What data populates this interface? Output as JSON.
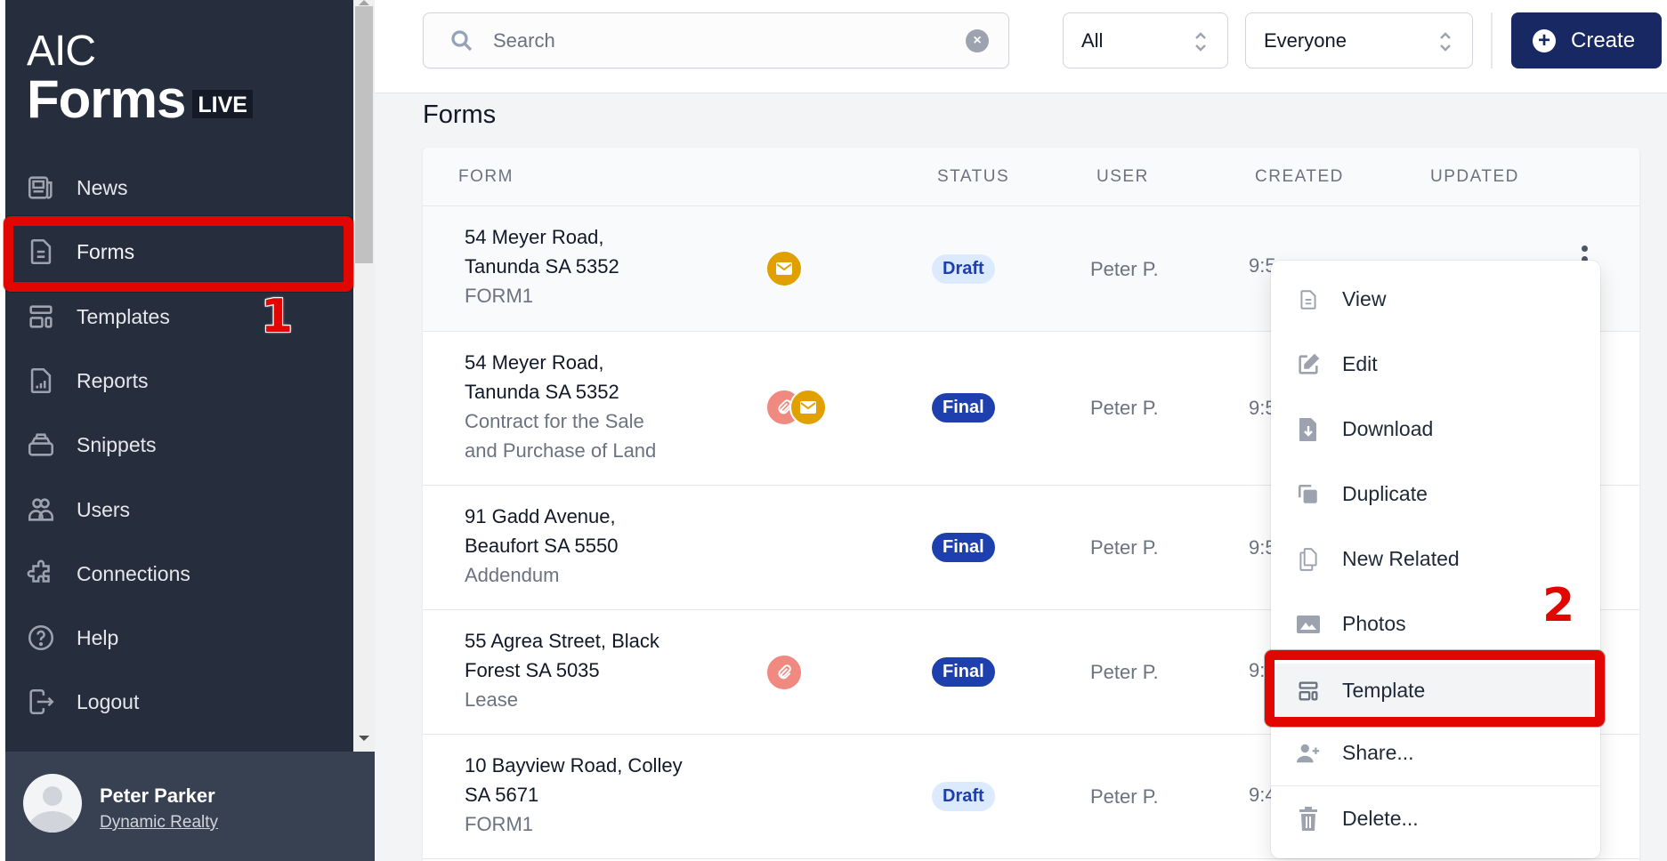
{
  "app": {
    "logo_line1": "AIC",
    "logo_line2": "Forms",
    "logo_badge": "LIVE"
  },
  "sidebar": {
    "items": [
      {
        "label": "News",
        "icon": "newspaper-icon"
      },
      {
        "label": "Forms",
        "icon": "document-icon",
        "active": true
      },
      {
        "label": "Templates",
        "icon": "template-icon"
      },
      {
        "label": "Reports",
        "icon": "report-icon"
      },
      {
        "label": "Snippets",
        "icon": "snippets-icon"
      },
      {
        "label": "Users",
        "icon": "users-icon"
      },
      {
        "label": "Connections",
        "icon": "puzzle-icon"
      },
      {
        "label": "Help",
        "icon": "help-icon"
      },
      {
        "label": "Logout",
        "icon": "logout-icon"
      }
    ],
    "user": {
      "name": "Peter Parker",
      "organization": "Dynamic Realty"
    }
  },
  "toolbar": {
    "search_placeholder": "Search",
    "search_value": "",
    "filter_type": "All",
    "filter_user": "Everyone",
    "create_label": "Create"
  },
  "page": {
    "title": "Forms"
  },
  "table": {
    "columns": [
      "FORM",
      "STATUS",
      "USER",
      "CREATED",
      "UPDATED"
    ],
    "rows": [
      {
        "address": [
          "54 Meyer Road,",
          "Tanunda SA 5352"
        ],
        "form_type": [
          "FORM1"
        ],
        "attachments": [
          "email"
        ],
        "status": "Draft",
        "user": "Peter P.",
        "created": "9:5",
        "updated": ""
      },
      {
        "address": [
          "54 Meyer Road,",
          "Tanunda SA 5352"
        ],
        "form_type": [
          "Contract for the Sale",
          "and Purchase of Land"
        ],
        "attachments": [
          "attachment",
          "email"
        ],
        "status": "Final",
        "user": "Peter P.",
        "created": "9:5",
        "updated": ""
      },
      {
        "address": [
          "91 Gadd Avenue,",
          "Beaufort SA 5550"
        ],
        "form_type": [
          "Addendum"
        ],
        "attachments": [],
        "status": "Final",
        "user": "Peter P.",
        "created": "9:5",
        "updated": ""
      },
      {
        "address": [
          "55 Agrea Street, Black",
          "Forest SA 5035"
        ],
        "form_type": [
          "Lease"
        ],
        "attachments": [
          "attachment"
        ],
        "status": "Final",
        "user": "Peter P.",
        "created": "9:",
        "updated": ""
      },
      {
        "address": [
          "10 Bayview Road, Colley",
          "SA 5671"
        ],
        "form_type": [
          "FORM1"
        ],
        "attachments": [],
        "status": "Draft",
        "user": "Peter P.",
        "created": "9:4",
        "updated": ""
      }
    ]
  },
  "context_menu": {
    "items": [
      {
        "label": "View",
        "icon": "document-icon"
      },
      {
        "label": "Edit",
        "icon": "edit-icon"
      },
      {
        "label": "Download",
        "icon": "download-icon"
      },
      {
        "label": "Duplicate",
        "icon": "duplicate-icon"
      },
      {
        "label": "New Related",
        "icon": "copy-icon"
      },
      {
        "label": "Photos",
        "icon": "photo-icon"
      },
      {
        "label": "Template",
        "icon": "template-icon",
        "highlighted": true
      },
      {
        "label": "Share...",
        "icon": "user-plus-icon"
      },
      {
        "label": "Delete...",
        "icon": "trash-icon"
      }
    ]
  },
  "annotations": {
    "step1": "1",
    "step2": "2"
  },
  "colors": {
    "sidebar_bg": "#262e3e",
    "user_panel_bg": "#374151",
    "primary": "#172863",
    "status_final": "#1e40af",
    "status_draft_bg": "#dbeafe",
    "email_badge": "#e0a100",
    "attachment_badge": "#f08a80",
    "annotation_red": "#e10600"
  }
}
